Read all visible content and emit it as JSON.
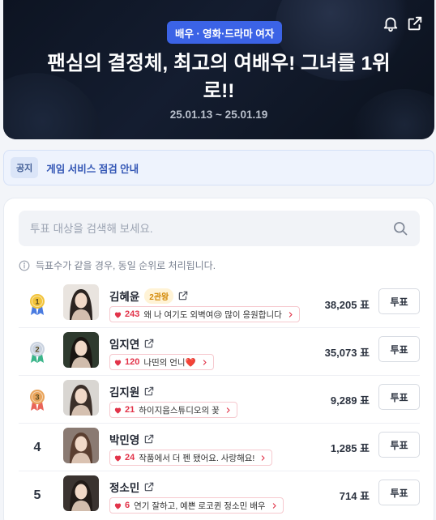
{
  "hero": {
    "category": "배우 · 영화·드라마 여자",
    "title": "팬심의 결정체, 최고의 여배우! 그녀를 1위로!!",
    "period": "25.01.13 ~ 25.01.19",
    "icons": [
      "bell-icon",
      "share-icon"
    ]
  },
  "notice": {
    "tag": "공지",
    "text": "게임 서비스 점검 안내"
  },
  "search": {
    "placeholder": "투표 대상을 검색해 보세요."
  },
  "tie_note": "득표수가 같을 경우, 동일 순위로 처리됩니다.",
  "medal_colors": {
    "gold": "#f2c33a",
    "silver": "#c9d2df",
    "bronze": "#e9a45b"
  },
  "accent_color": "#3b63e6",
  "candidates": [
    {
      "rank": "1",
      "name": "김혜윤",
      "badge": "2관왕",
      "comment_count": "243",
      "comment": "왜 나 여기도 외벽여😢 많이 응원합니다",
      "votes": "38,205 표",
      "vote_label": "투표",
      "avatar_colors": [
        "#e9e4df",
        "#2b2421"
      ]
    },
    {
      "rank": "2",
      "name": "임지연",
      "badge": "",
      "comment_count": "120",
      "comment": "나띤의 언니❤️",
      "votes": "35,073 표",
      "vote_label": "투표",
      "avatar_colors": [
        "#2e3a2e",
        "#1a1512"
      ]
    },
    {
      "rank": "3",
      "name": "김지원",
      "badge": "",
      "comment_count": "21",
      "comment": "하이지음스튜디오의 꽃",
      "votes": "9,289 표",
      "vote_label": "투표",
      "avatar_colors": [
        "#d9d6d2",
        "#3b2f29"
      ]
    },
    {
      "rank": "4",
      "name": "박민영",
      "badge": "",
      "comment_count": "24",
      "comment": "작품에서 더 펜 됐어요. 사랑해요!",
      "votes": "1,285 표",
      "vote_label": "투표",
      "avatar_colors": [
        "#8a7a72",
        "#5a3e30"
      ]
    },
    {
      "rank": "5",
      "name": "정소민",
      "badge": "",
      "comment_count": "6",
      "comment": "연기 잘하고, 예쁜 로코퀸 정소민 배우",
      "votes": "714 표",
      "vote_label": "투표",
      "avatar_colors": [
        "#3a3330",
        "#221b18"
      ]
    }
  ]
}
